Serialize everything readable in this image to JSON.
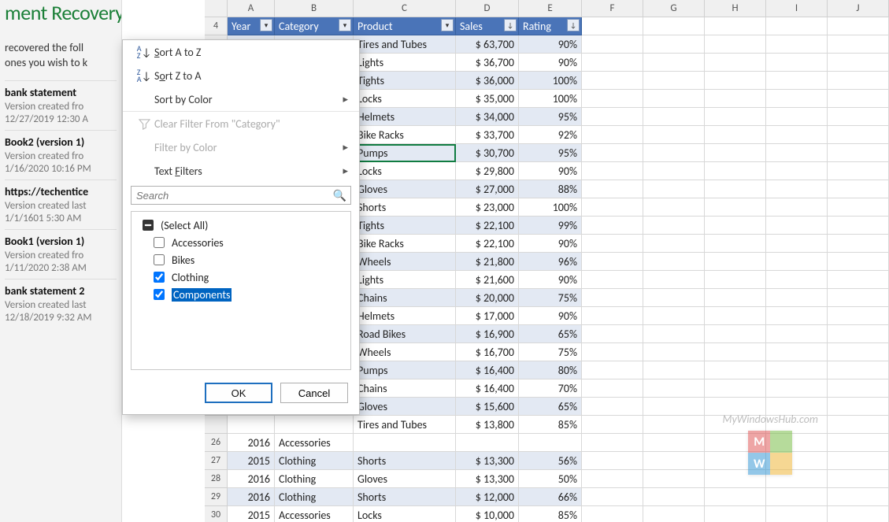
{
  "recovery": {
    "title_fragment": "ment Recovery",
    "desc_line1": "recovered the foll",
    "desc_line2": "ones you wish to k",
    "items": [
      {
        "title": "bank statement",
        "sub": "Version created fro",
        "date": "12/27/2019 12:30 A"
      },
      {
        "title": "Book2 (version 1)",
        "sub": "Version created fro",
        "date": "1/16/2020 10:16 PM"
      },
      {
        "title": "https://techentice",
        "sub": "Version created last",
        "date": "1/1/1601 5:30 AM"
      },
      {
        "title": "Book1 (version 1)",
        "sub": "Version created fro",
        "date": "1/11/2020 2:38 AM"
      },
      {
        "title": "bank statement 2",
        "sub": "Version created last",
        "date": "12/18/2019 9:32 AM"
      }
    ]
  },
  "columns": {
    "letters": [
      "A",
      "B",
      "C",
      "D",
      "E",
      "F",
      "G",
      "H",
      "I",
      "J"
    ]
  },
  "table_headers": {
    "row_num": "4",
    "year": "Year",
    "category": "Category",
    "product": "Product",
    "sales": "Sales",
    "rating": "Rating"
  },
  "rows_upper": [
    {
      "product": "Tires and Tubes",
      "sales": "$ 63,700",
      "rating": "90%"
    },
    {
      "product": "Lights",
      "sales": "$ 36,700",
      "rating": "90%"
    },
    {
      "product": "Tights",
      "sales": "$ 36,000",
      "rating": "100%"
    },
    {
      "product": "Locks",
      "sales": "$ 35,000",
      "rating": "100%"
    },
    {
      "product": "Helmets",
      "sales": "$ 34,000",
      "rating": "95%"
    },
    {
      "product": "Bike Racks",
      "sales": "$ 33,700",
      "rating": "92%"
    },
    {
      "product": "Pumps",
      "sales": "$ 30,700",
      "rating": "95%"
    },
    {
      "product": "Locks",
      "sales": "$ 29,800",
      "rating": "90%"
    },
    {
      "product": "Gloves",
      "sales": "$ 27,000",
      "rating": "88%"
    },
    {
      "product": "Shorts",
      "sales": "$ 23,000",
      "rating": "100%"
    },
    {
      "product": "Tights",
      "sales": "$ 22,100",
      "rating": "99%"
    },
    {
      "product": "Bike Racks",
      "sales": "$ 22,100",
      "rating": "90%"
    },
    {
      "product": "Wheels",
      "sales": "$ 21,800",
      "rating": "96%"
    },
    {
      "product": "Lights",
      "sales": "$ 21,600",
      "rating": "90%"
    },
    {
      "product": "Chains",
      "sales": "$ 20,000",
      "rating": "75%"
    },
    {
      "product": "Helmets",
      "sales": "$ 17,000",
      "rating": "90%"
    },
    {
      "product": "Road Bikes",
      "sales": "$ 16,900",
      "rating": "65%"
    },
    {
      "product": "Wheels",
      "sales": "$ 16,700",
      "rating": "75%"
    },
    {
      "product": "Pumps",
      "sales": "$ 16,400",
      "rating": "80%"
    },
    {
      "product": "Chains",
      "sales": "$ 16,400",
      "rating": "70%"
    },
    {
      "product": "Gloves",
      "sales": "$ 15,600",
      "rating": "65%"
    },
    {
      "product": "Tires and Tubes",
      "sales": "$ 13,800",
      "rating": "85%"
    }
  ],
  "rows_lower": [
    {
      "n": "26",
      "year": "2016",
      "cat": "Accessories",
      "product": "",
      "sales": "",
      "rating": ""
    },
    {
      "n": "27",
      "year": "2015",
      "cat": "Clothing",
      "product": "Shorts",
      "sales": "$ 13,300",
      "rating": "56%"
    },
    {
      "n": "28",
      "year": "2016",
      "cat": "Clothing",
      "product": "Gloves",
      "sales": "$ 13,300",
      "rating": "50%"
    },
    {
      "n": "29",
      "year": "2016",
      "cat": "Clothing",
      "product": "Shorts",
      "sales": "$ 12,000",
      "rating": "66%"
    },
    {
      "n": "30",
      "year": "2015",
      "cat": "Accessories",
      "product": "Locks",
      "sales": "$ 10,000",
      "rating": "85%"
    }
  ],
  "filter_menu": {
    "sort_az": "Sort A to Z",
    "sort_za": "Sort Z to A",
    "sort_color": "Sort by Color",
    "clear_filter": "Clear Filter From \"Category\"",
    "filter_color": "Filter by Color",
    "text_filters": "Text Filters",
    "search_placeholder": "Search",
    "options": {
      "select_all": "(Select All)",
      "o1": "Accessories",
      "o2": "Bikes",
      "o3": "Clothing",
      "o4": "Components"
    },
    "ok": "OK",
    "cancel": "Cancel"
  },
  "watermark": {
    "text": "MyWindowsHub.com",
    "m": "M",
    "w": "W"
  }
}
